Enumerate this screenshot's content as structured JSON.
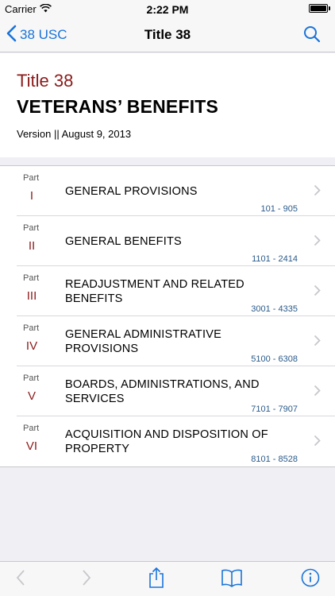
{
  "status_bar": {
    "carrier": "Carrier",
    "time": "2:22 PM"
  },
  "nav": {
    "back_label": "38 USC",
    "title": "Title 38"
  },
  "header": {
    "title_number": "Title 38",
    "title_name": "VETERANS’ BENEFITS",
    "version": "Version || August 9, 2013"
  },
  "parts": [
    {
      "label": "Part",
      "numeral": "I",
      "title": "GENERAL PROVISIONS",
      "range": "101 - 905"
    },
    {
      "label": "Part",
      "numeral": "II",
      "title": "GENERAL BENEFITS",
      "range": "1101 - 2414"
    },
    {
      "label": "Part",
      "numeral": "III",
      "title": "READJUSTMENT AND RELATED BENEFITS",
      "range": "3001 - 4335"
    },
    {
      "label": "Part",
      "numeral": "IV",
      "title": "GENERAL ADMINISTRATIVE PROVISIONS",
      "range": "5100 - 6308"
    },
    {
      "label": "Part",
      "numeral": "V",
      "title": "BOARDS, ADMINISTRATIONS, AND SERVICES",
      "range": "7101 - 7907"
    },
    {
      "label": "Part",
      "numeral": "VI",
      "title": "ACQUISITION AND DISPOSITION OF PROPERTY",
      "range": "8101 - 8528"
    }
  ],
  "toolbar": {
    "icons": [
      "back-arrow-icon",
      "forward-arrow-icon",
      "share-icon",
      "bookmarks-book-icon",
      "info-icon"
    ]
  },
  "colors": {
    "accent": "#1a73d9",
    "title_red": "#8b1a1a",
    "range_blue": "#2a5a8a",
    "background": "#efeff4"
  }
}
